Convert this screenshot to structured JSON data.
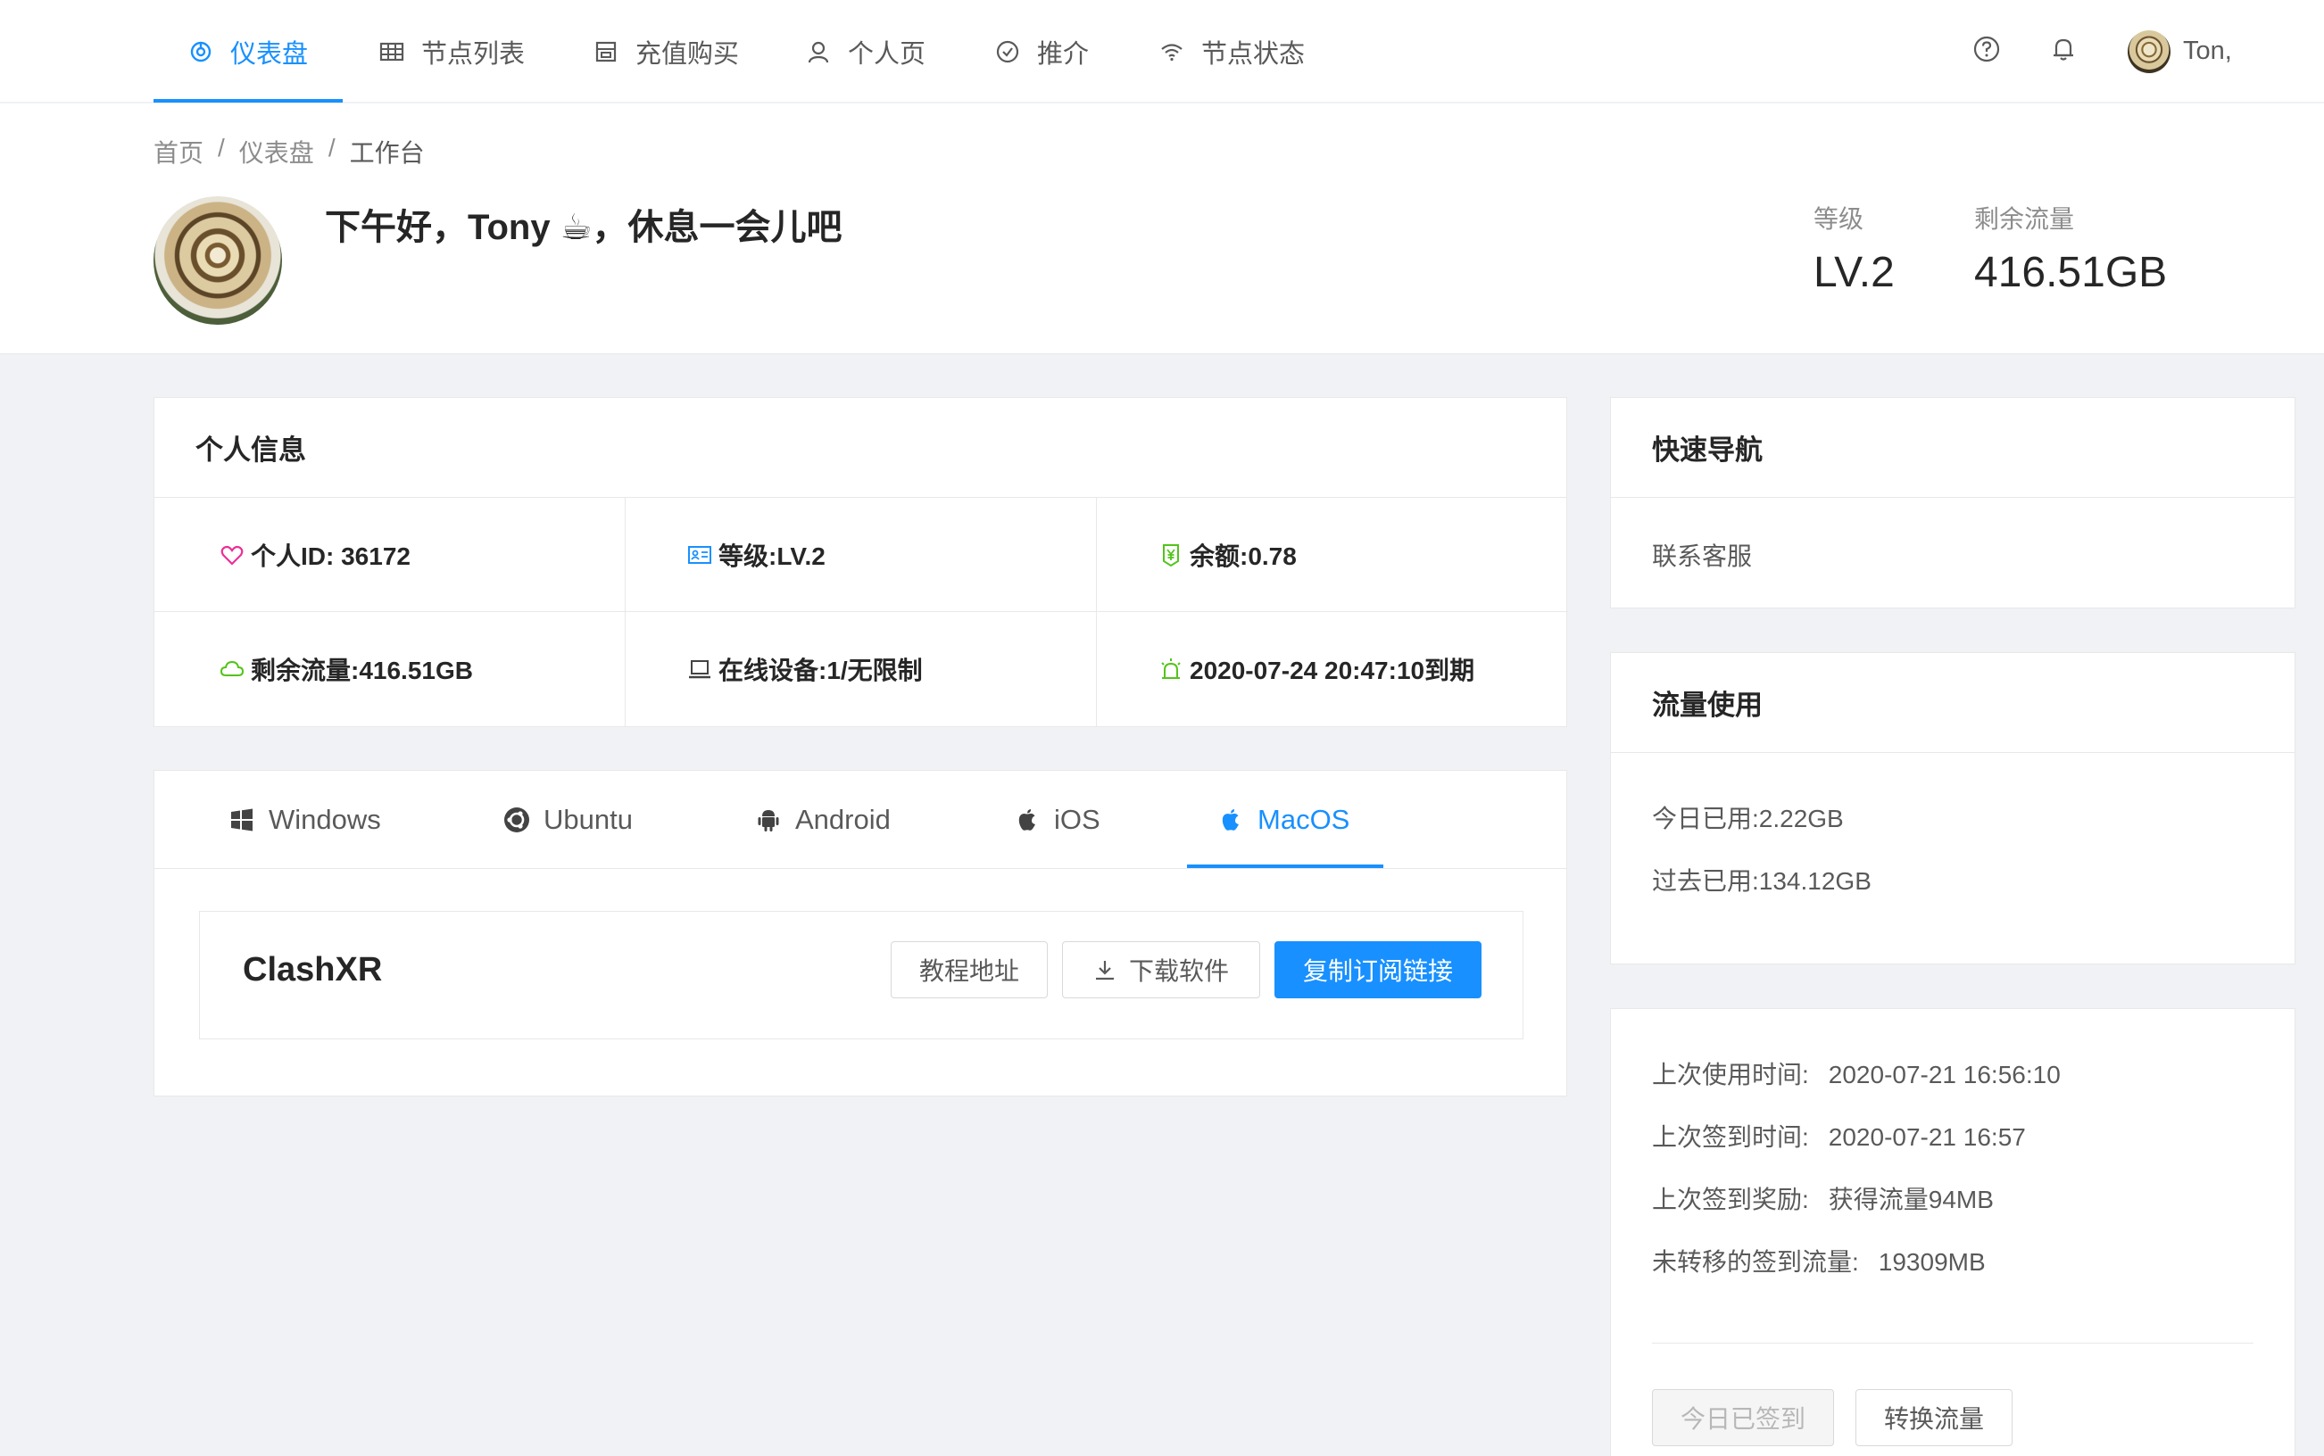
{
  "nav": {
    "items": [
      {
        "label": "仪表盘",
        "icon": "dashboard-icon",
        "active": true
      },
      {
        "label": "节点列表",
        "icon": "table-icon",
        "active": false
      },
      {
        "label": "充值购买",
        "icon": "shop-icon",
        "active": false
      },
      {
        "label": "个人页",
        "icon": "user-icon",
        "active": false
      },
      {
        "label": "推介",
        "icon": "check-circle-icon",
        "active": false
      },
      {
        "label": "节点状态",
        "icon": "wifi-icon",
        "active": false
      }
    ],
    "user_name": "Ton,",
    "accent": "#1890ff"
  },
  "breadcrumb": {
    "home": "首页",
    "dashboard": "仪表盘",
    "current": "工作台",
    "separator": "/"
  },
  "header": {
    "greeting": "下午好，Tony ☕，休息一会儿吧",
    "level_label": "等级",
    "level_value": "LV.2",
    "traffic_label": "剩余流量",
    "traffic_value": "416.51GB"
  },
  "personal_info": {
    "title": "个人信息",
    "cells": [
      {
        "icon": "heart-icon",
        "text": "个人ID: 36172"
      },
      {
        "icon": "idcard-icon",
        "text": "等级:LV.2"
      },
      {
        "icon": "wallet-icon",
        "text": "余额:0.78"
      },
      {
        "icon": "cloud-icon",
        "text": "剩余流量:416.51GB"
      },
      {
        "icon": "laptop-icon",
        "text": "在线设备:1/无限制"
      },
      {
        "icon": "alert-icon",
        "text": "2020-07-24 20:47:10到期"
      }
    ]
  },
  "platform_tabs": {
    "tabs": [
      {
        "label": "Windows",
        "icon": "windows-icon",
        "active": false
      },
      {
        "label": "Ubuntu",
        "icon": "ubuntu-icon",
        "active": false
      },
      {
        "label": "Android",
        "icon": "android-icon",
        "active": false
      },
      {
        "label": "iOS",
        "icon": "apple-icon",
        "active": false
      },
      {
        "label": "MacOS",
        "icon": "apple-icon",
        "active": true
      }
    ],
    "software_name": "ClashXR",
    "tutorial_button": "教程地址",
    "download_button": "下载软件",
    "copy_button": "复制订阅链接"
  },
  "quick_nav": {
    "title": "快速导航",
    "link": "联系客服"
  },
  "traffic_usage": {
    "title": "流量使用",
    "today": "今日已用:2.22GB",
    "past": "过去已用:134.12GB"
  },
  "checkin": {
    "rows": [
      {
        "label": "上次使用时间:",
        "value": "2020-07-21 16:56:10"
      },
      {
        "label": "上次签到时间:",
        "value": "2020-07-21 16:57"
      },
      {
        "label": "上次签到奖励:",
        "value": "获得流量94MB"
      },
      {
        "label": "未转移的签到流量:",
        "value": "19309MB"
      }
    ],
    "checked_button": "今日已签到",
    "convert_button": "转换流量"
  }
}
